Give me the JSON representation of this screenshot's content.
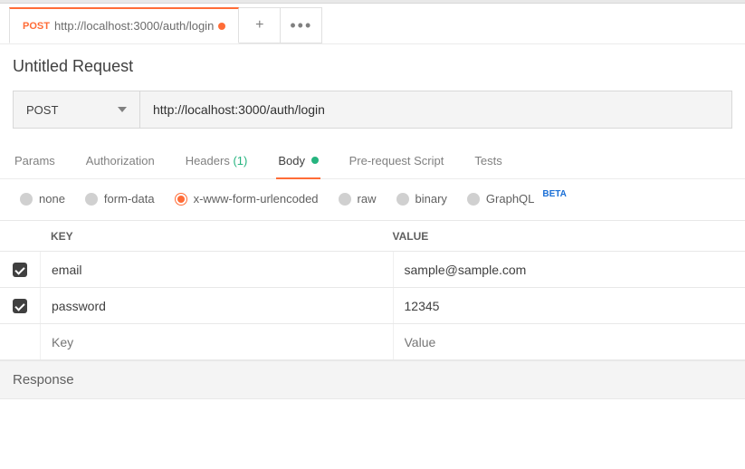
{
  "tab": {
    "method": "POST",
    "url": "http://localhost:3000/auth/login"
  },
  "title": "Untitled Request",
  "request": {
    "method": "POST",
    "url": "http://localhost:3000/auth/login"
  },
  "subtabs": {
    "params": "Params",
    "auth": "Authorization",
    "headers": "Headers",
    "headers_count": "(1)",
    "body": "Body",
    "prerequest": "Pre-request Script",
    "tests": "Tests"
  },
  "body_types": {
    "none": "none",
    "formdata": "form-data",
    "urlencoded": "x-www-form-urlencoded",
    "raw": "raw",
    "binary": "binary",
    "graphql": "GraphQL",
    "beta": "BETA"
  },
  "kv": {
    "key_header": "KEY",
    "value_header": "VALUE",
    "rows": [
      {
        "key": "email",
        "value": "sample@sample.com"
      },
      {
        "key": "password",
        "value": "12345"
      }
    ],
    "key_placeholder": "Key",
    "value_placeholder": "Value"
  },
  "response_label": "Response"
}
